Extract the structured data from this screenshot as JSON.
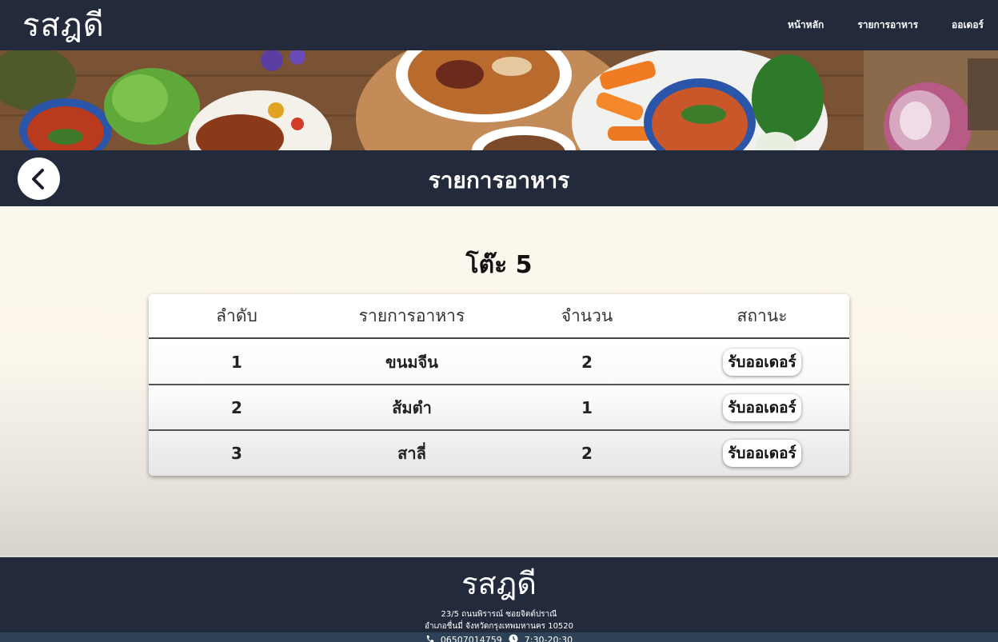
{
  "header": {
    "logo": "รสฎดี",
    "nav": [
      "หน้าหลัก",
      "รายการอาหาร",
      "ออเดอร์"
    ]
  },
  "titlebar": {
    "title": "รายการอาหาร"
  },
  "main": {
    "table_label": "โต๊ะ 5",
    "columns": [
      "ลำดับ",
      "รายการอาหาร",
      "จำนวน",
      "สถานะ"
    ],
    "rows": [
      {
        "no": "1",
        "item": "ขนมจีน",
        "qty": "2",
        "status": "รับออเดอร์"
      },
      {
        "no": "2",
        "item": "ส้มตำ",
        "qty": "1",
        "status": "รับออเดอร์"
      },
      {
        "no": "3",
        "item": "สาลี่",
        "qty": "2",
        "status": "รับออเดอร์"
      }
    ]
  },
  "footer": {
    "logo": "รสฎดี",
    "address_line1": "23/5 ถนนพิรารณ์ ซอยจิตต์ปราณี",
    "address_line2": "อำเภอชื่นมี่ จังหวัดกรุงเทพมหานคร 10520",
    "phone": "06507014759",
    "hours": "7:30-20:30"
  },
  "icons": {
    "back": "chevron-left-icon",
    "phone": "phone-icon",
    "clock": "clock-icon"
  },
  "colors": {
    "navy": "#232a3c",
    "cream": "#fdf8ee",
    "white": "#ffffff"
  }
}
